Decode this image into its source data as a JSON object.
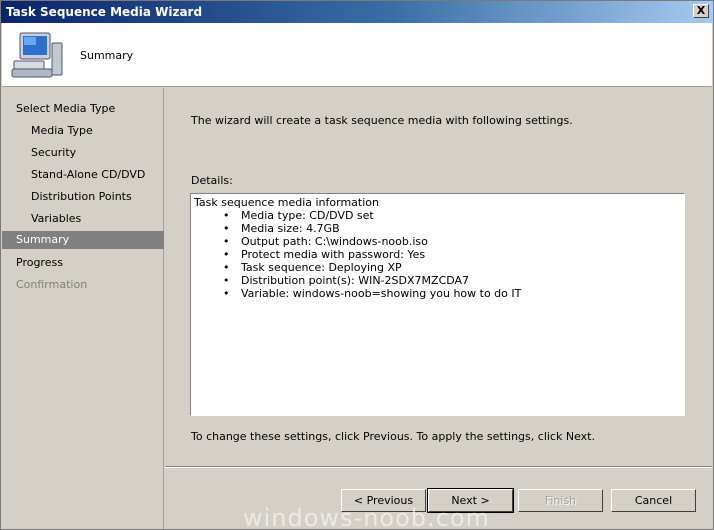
{
  "window": {
    "title": "Task Sequence Media Wizard",
    "close_glyph": "X"
  },
  "header": {
    "title": "Summary",
    "icon": "computer-icon"
  },
  "sidebar": {
    "items": [
      {
        "label": "Select Media Type",
        "state": "normal",
        "level": "top"
      },
      {
        "label": "Media Type",
        "state": "normal",
        "level": "sub"
      },
      {
        "label": "Security",
        "state": "normal",
        "level": "sub"
      },
      {
        "label": "Stand-Alone CD/DVD",
        "state": "normal",
        "level": "sub"
      },
      {
        "label": "Distribution Points",
        "state": "normal",
        "level": "sub"
      },
      {
        "label": "Variables",
        "state": "normal",
        "level": "sub"
      },
      {
        "label": "Summary",
        "state": "active",
        "level": "top"
      },
      {
        "label": "Progress",
        "state": "normal",
        "level": "top"
      },
      {
        "label": "Confirmation",
        "state": "disabled",
        "level": "top"
      }
    ]
  },
  "main": {
    "intro": "The wizard will create a task sequence media with following settings.",
    "details_label": "Details:",
    "details": {
      "heading": "Task sequence media information",
      "lines": [
        "Media type: CD/DVD set",
        "Media size: 4.7GB",
        "Output path: C:\\windows-noob.iso",
        "Protect media with password: Yes",
        "Task sequence: Deploying XP",
        "Distribution point(s): WIN-2SDX7MZCDA7",
        "Variable: windows-noob=showing you how to do IT"
      ]
    },
    "footer_text": "To change these settings, click Previous. To apply the settings, click Next."
  },
  "buttons": {
    "previous": "< Previous",
    "next": "Next >",
    "finish": "Finish",
    "cancel": "Cancel"
  },
  "watermark": "windows-noob.com"
}
